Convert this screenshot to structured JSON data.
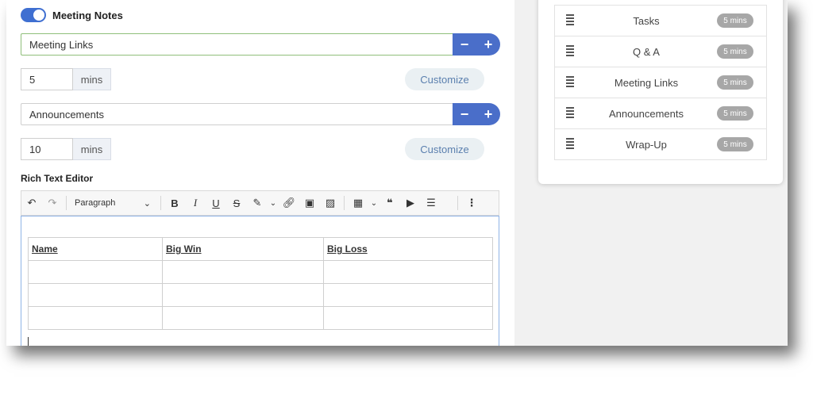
{
  "meeting_notes": {
    "toggle_label": "Meeting Notes",
    "enabled": true
  },
  "sections": [
    {
      "name": "Meeting Links",
      "minutes": "5",
      "unit": "mins",
      "customize_label": "Customize",
      "minus": "−",
      "plus": "+"
    },
    {
      "name": "Announcements",
      "minutes": "10",
      "unit": "mins",
      "customize_label": "Customize",
      "minus": "−",
      "plus": "+"
    }
  ],
  "rich_text_editor": {
    "label": "Rich Text Editor",
    "block_style": "Paragraph",
    "table_headers": [
      "Name",
      "Big Win",
      "Big Loss"
    ],
    "table_rows": [
      [
        "",
        "",
        ""
      ],
      [
        "",
        "",
        ""
      ],
      [
        "",
        "",
        ""
      ]
    ]
  },
  "agenda": {
    "items": [
      {
        "label": "Tasks",
        "duration": "5 mins"
      },
      {
        "label": "Q & A",
        "duration": "5 mins"
      },
      {
        "label": "Meeting Links",
        "duration": "5 mins"
      },
      {
        "label": "Announcements",
        "duration": "5 mins"
      },
      {
        "label": "Wrap-Up",
        "duration": "5 mins"
      }
    ]
  },
  "colors": {
    "accent": "#4a6ec9",
    "active_border": "#8fbf7a",
    "pill": "#a7a7a7"
  }
}
